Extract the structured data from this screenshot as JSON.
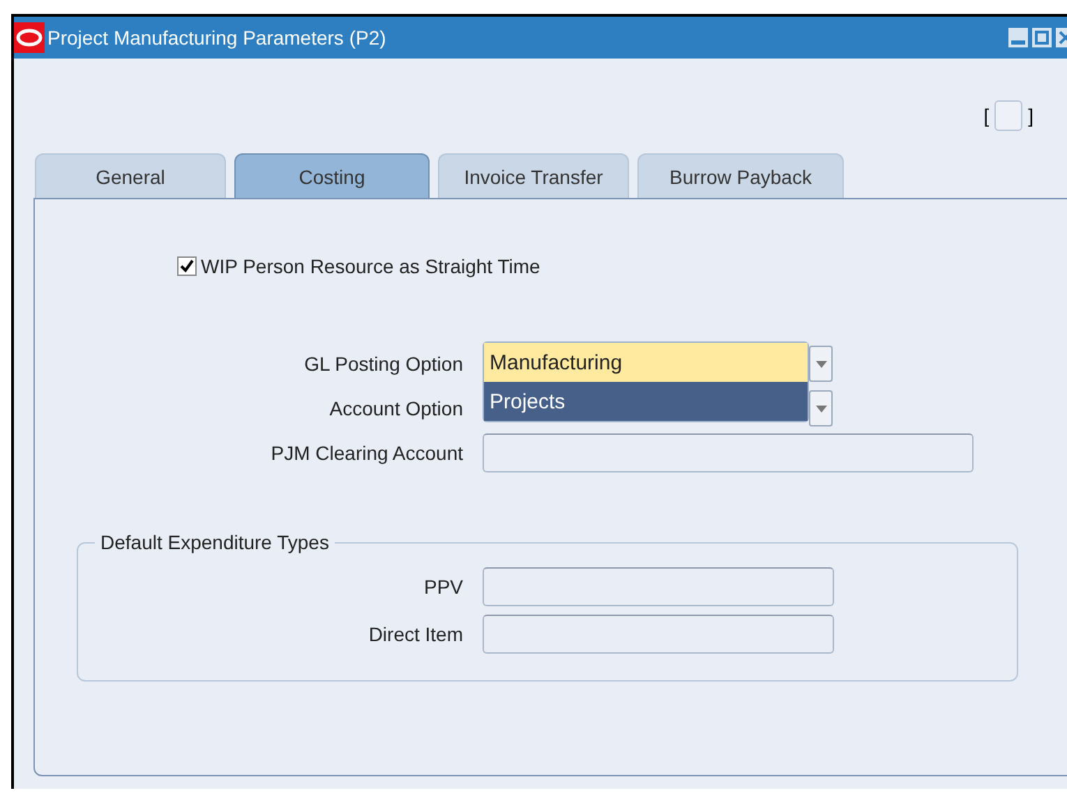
{
  "window": {
    "title": "Project Manufacturing Parameters (P2)"
  },
  "indicator": {
    "open": "[",
    "close": "]"
  },
  "tabs": [
    {
      "label": "General",
      "selected": false
    },
    {
      "label": "Costing",
      "selected": true
    },
    {
      "label": "Invoice Transfer",
      "selected": false
    },
    {
      "label": "Burrow Payback",
      "selected": false
    }
  ],
  "checkbox": {
    "label": "WIP Person Resource as Straight Time",
    "checked": true
  },
  "fields": [
    {
      "label": "GL Posting Option",
      "kind": "dropdown"
    },
    {
      "label": "Account Option",
      "kind": "dropdown"
    },
    {
      "label": "PJM Clearing Account",
      "kind": "text"
    }
  ],
  "dropdown_list": [
    {
      "label": "Manufacturing",
      "selected": false
    },
    {
      "label": "Projects",
      "selected": true
    }
  ],
  "group": {
    "title": "Default Expenditure Types",
    "fields": [
      {
        "label": "PPV"
      },
      {
        "label": "Direct Item"
      }
    ]
  }
}
